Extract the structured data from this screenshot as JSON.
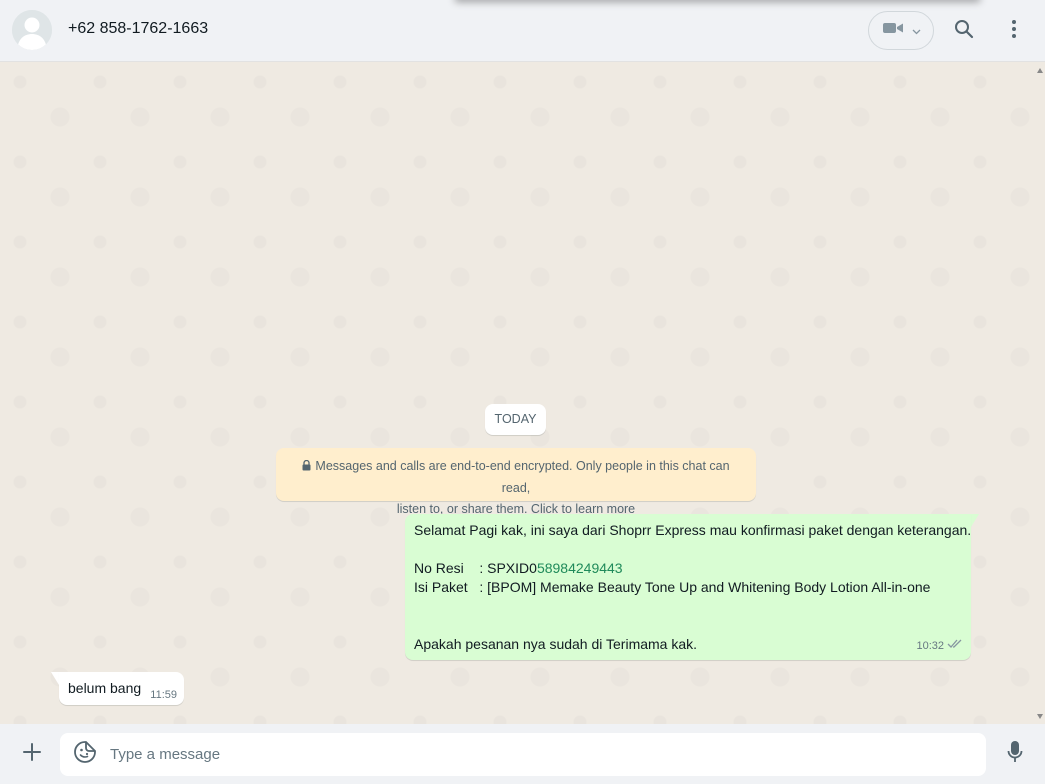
{
  "header": {
    "contact_name": "+62 858-1762-1663",
    "icons": {
      "avatar": "default-avatar-icon",
      "video": "video-camera-icon",
      "video_dropdown": "chevron-down-icon",
      "search": "search-icon",
      "menu": "more-vertical-icon"
    }
  },
  "chat": {
    "date_chip": "TODAY",
    "encryption_notice": {
      "line1": "Messages and calls are end-to-end encrypted. Only people in this chat can read,",
      "line2": "listen to, or share them. Click to learn more"
    },
    "outgoing_message": {
      "line1": "Selamat Pagi kak, ini saya dari Shoprr Express mau konfirmasi paket dengan keterangan.",
      "resi_prefix": "No Resi    : SPXID0",
      "resi_link": "58984249443",
      "isi_paket": "Isi Paket   : [BPOM] Memake Beauty Tone Up and Whitening Body Lotion All-in-one",
      "closing": "Apakah pesanan nya sudah di Terimama kak.",
      "time": "10:32",
      "status": "double-check-icon"
    },
    "incoming_message": {
      "text": "belum bang",
      "time": "11:59"
    }
  },
  "composer": {
    "placeholder": "Type a message",
    "icons": {
      "attach": "plus-icon",
      "sticker": "sticker-icon",
      "mic": "microphone-icon"
    }
  },
  "colors": {
    "outgoing_bubble": "#d9fdd3",
    "encryption_bg": "#ffeecd",
    "chat_bg": "#efeae2",
    "header_bg": "#f0f2f5"
  }
}
